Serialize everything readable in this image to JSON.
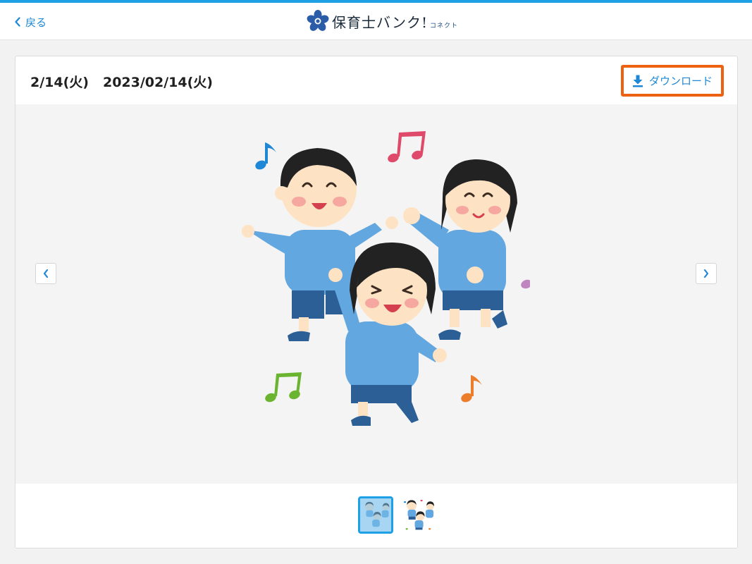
{
  "header": {
    "back_label": "戻る",
    "logo_text": "保育士バンク!",
    "logo_sub": "コネクト"
  },
  "post": {
    "short_date": "2/14(火)",
    "full_date": "2023/02/14(火)",
    "download_label": "ダウンロード"
  },
  "gallery": {
    "current_index": 1,
    "total": 2
  },
  "icons": {
    "back": "chevron-left-icon",
    "download": "download-icon",
    "prev": "chevron-left-icon",
    "next": "chevron-right-icon"
  },
  "colors": {
    "accent": "#1e88d6",
    "topbar": "#1ea0e6",
    "highlight": "#ec6211"
  }
}
